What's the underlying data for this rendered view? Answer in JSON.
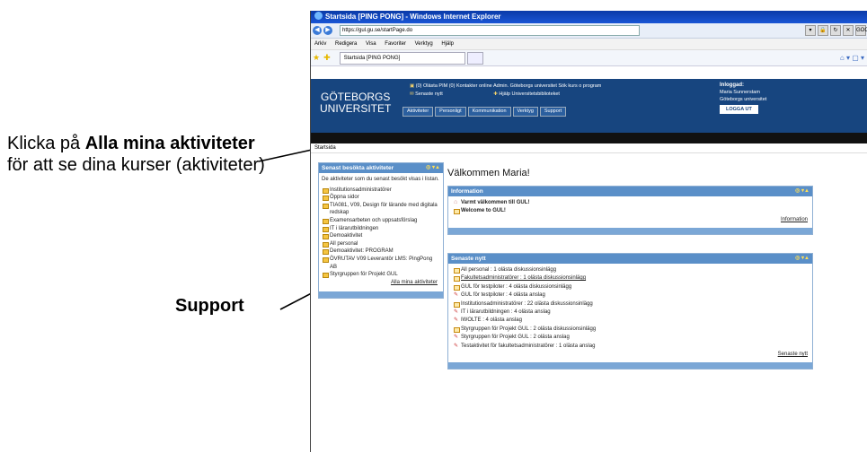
{
  "annotations": {
    "a1_pre": "Klicka på ",
    "a1_bold": "Alla mina aktiviteter",
    "a1_post": " för att se dina kurser (aktiviteter)",
    "a2": "Support"
  },
  "browser": {
    "title": "Startsida [PING PONG] - Windows Internet Explorer",
    "url": "https://gul.gu.se/startPage.do",
    "search": "GOOGLE",
    "menu": [
      "Arkiv",
      "Redigera",
      "Visa",
      "Favoriter",
      "Verktyg",
      "Hjälp"
    ],
    "tab": "Startsida [PING PONG]"
  },
  "header": {
    "logo_line1": "GÖTEBORGS",
    "logo_line2": "UNIVERSITET",
    "links_row1": "(0) Olästa PIM  (0) Kontakter online  Admin.  Göteborgs universitet  Sök kurs o program",
    "links_row2a": "Senaste nytt",
    "links_row2b": "Hjälp  Universitetsbiblioteket",
    "nav": [
      "Aktiviteter",
      "Personligt",
      "Kommunikation",
      "Verktyg",
      "Support"
    ],
    "login_title": "Inloggad:",
    "login_name": "Maria Sunnerstam",
    "login_org": "Göteborgs universitet",
    "logout": "LOGGA UT"
  },
  "breadcrumb": "Startsida",
  "left_panel": {
    "title": "Senast besökta aktiviteter",
    "intro": "De aktiviteter som du senast besökt visas i listan.",
    "items": [
      "Institutionsadministratörer",
      "Öppna sidor",
      "TIA081, V09, Design för lärande med digitala redskap",
      "Examensarbeten och uppsatsförslag",
      "IT i lärarutbildningen",
      "Demoaktivitet",
      "All personal",
      "Demoaktivitet: PROGRAM",
      "ÖVRUTAV V09 Leverantör LMS: PingPong AB",
      "Styrgruppen för Projekt GUL"
    ],
    "all_link": "Alla mina aktiviteter"
  },
  "welcome": "Välkommen Maria!",
  "info_panel": {
    "title": "Information",
    "items": [
      "Varmt välkommen till GUL!",
      "Welcome to GUL!"
    ],
    "link": "Information"
  },
  "news_panel": {
    "title": "Senaste nytt",
    "items": [
      "All personal : 1 olästa diskussionsinlägg",
      "Fakultetsadministratörer : 1 olästa diskussionsinlägg",
      "GUL för testpiloter : 4 olästa diskussionsinlägg",
      "GUL för testpiloter : 4 olästa anslag",
      "Institutionsadministratörer : 22 olästa diskussionsinlägg",
      "IT i lärarutbildningen : 4 olästa anslag",
      "IWOLTE : 4 olästa anslag",
      "Styrgruppen för Projekt GUL : 2 olästa diskussionsinlägg",
      "Styrgruppen för Projekt GUL : 2 olästa anslag",
      "Testaktivitet för fakultetsadministratörer : 1 olästa anslag"
    ],
    "link": "Senaste nytt"
  }
}
